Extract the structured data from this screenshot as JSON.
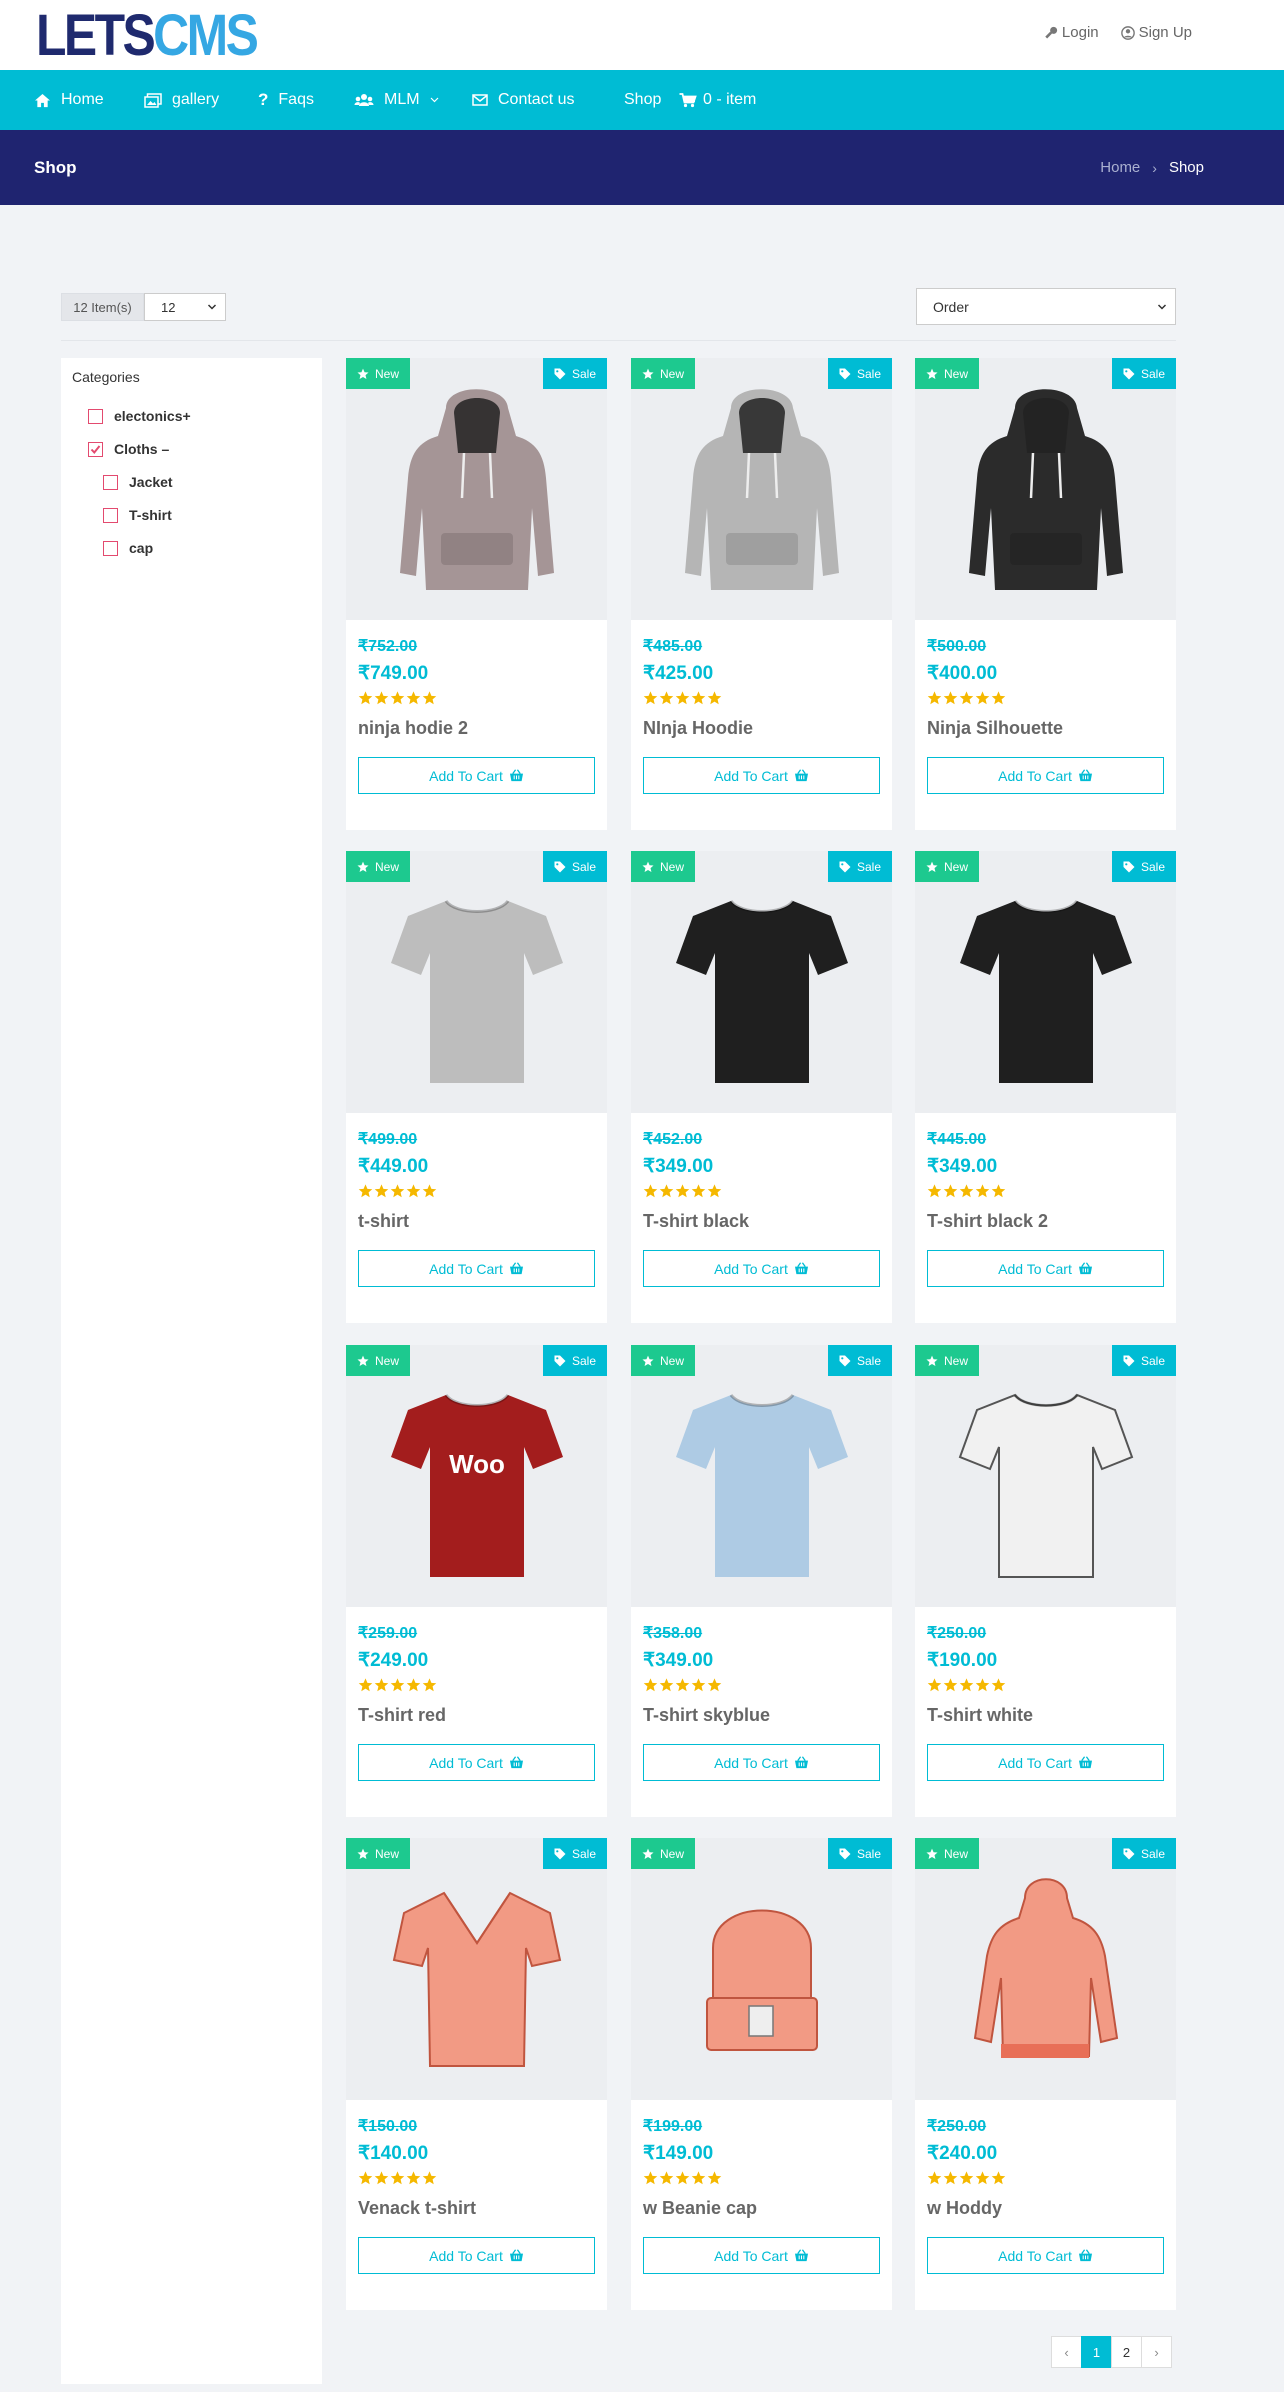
{
  "header": {
    "logo_part1": "LETS",
    "logo_part2": "CMS",
    "login_label": "Login",
    "signup_label": "Sign Up"
  },
  "nav": {
    "home": "Home",
    "gallery": "gallery",
    "faqs": "Faqs",
    "mlm": "MLM",
    "contact": "Contact us",
    "shop": "Shop",
    "cart": "0 - item"
  },
  "pagehead": {
    "title": "Shop",
    "breadcrumb_home": "Home",
    "breadcrumb_current": "Shop"
  },
  "toolbar": {
    "items_label": "12 Item(s)",
    "per_page_value": "12",
    "order_value": "Order"
  },
  "sidebar": {
    "title": "Categories",
    "categories": [
      {
        "label": "electonics",
        "toggle": "+",
        "checked": false
      },
      {
        "label": "Cloths",
        "toggle": "–",
        "checked": true
      },
      {
        "label": "Jacket",
        "toggle": "",
        "checked": false
      },
      {
        "label": "T-shirt",
        "toggle": "",
        "checked": false
      },
      {
        "label": "cap",
        "toggle": "",
        "checked": false
      }
    ]
  },
  "badges": {
    "new": "New",
    "sale": "Sale"
  },
  "add_to_cart_label": "Add To Cart",
  "rating_stars": 5,
  "products": [
    {
      "name": "ninja hodie 2",
      "old_price": "₹752.00",
      "price": "₹749.00",
      "image": "hoodie",
      "color": "#a59596"
    },
    {
      "name": "NInja Hoodie",
      "old_price": "₹485.00",
      "price": "₹425.00",
      "image": "hoodie",
      "color": "#b5b5b5"
    },
    {
      "name": "Ninja Silhouette",
      "old_price": "₹500.00",
      "price": "₹400.00",
      "image": "hoodie",
      "color": "#2b2b2b"
    },
    {
      "name": "t-shirt",
      "old_price": "₹499.00",
      "price": "₹449.00",
      "image": "tshirt",
      "color": "#bdbdbd"
    },
    {
      "name": "T-shirt black",
      "old_price": "₹452.00",
      "price": "₹349.00",
      "image": "tshirt",
      "color": "#1f1f1f"
    },
    {
      "name": "T-shirt black 2",
      "old_price": "₹445.00",
      "price": "₹349.00",
      "image": "tshirt",
      "color": "#1f1f1f"
    },
    {
      "name": "T-shirt red",
      "old_price": "₹259.00",
      "price": "₹249.00",
      "image": "tshirt",
      "color": "#a31d1d",
      "print": "Woo"
    },
    {
      "name": "T-shirt skyblue",
      "old_price": "₹358.00",
      "price": "₹349.00",
      "image": "tshirt",
      "color": "#aecbe4"
    },
    {
      "name": "T-shirt white",
      "old_price": "₹250.00",
      "price": "₹190.00",
      "image": "tshirt-outline",
      "color": "#f1f1f1"
    },
    {
      "name": "Venack t-shirt",
      "old_price": "₹150.00",
      "price": "₹140.00",
      "image": "vneck",
      "color": "#f29a84"
    },
    {
      "name": "w Beanie cap",
      "old_price": "₹199.00",
      "price": "₹149.00",
      "image": "beanie",
      "color": "#f29a84"
    },
    {
      "name": "w Hoddy",
      "old_price": "₹250.00",
      "price": "₹240.00",
      "image": "hoodie-outline",
      "color": "#f29a84"
    }
  ],
  "pagination": {
    "prev": "‹",
    "pages": [
      "1",
      "2"
    ],
    "next": "›",
    "current": "1"
  },
  "colors": {
    "accent": "#00bcd4",
    "new_badge": "#1dc98f",
    "page_header": "#1f2470",
    "star": "#f5b800",
    "checkbox": "#e34a6f"
  }
}
